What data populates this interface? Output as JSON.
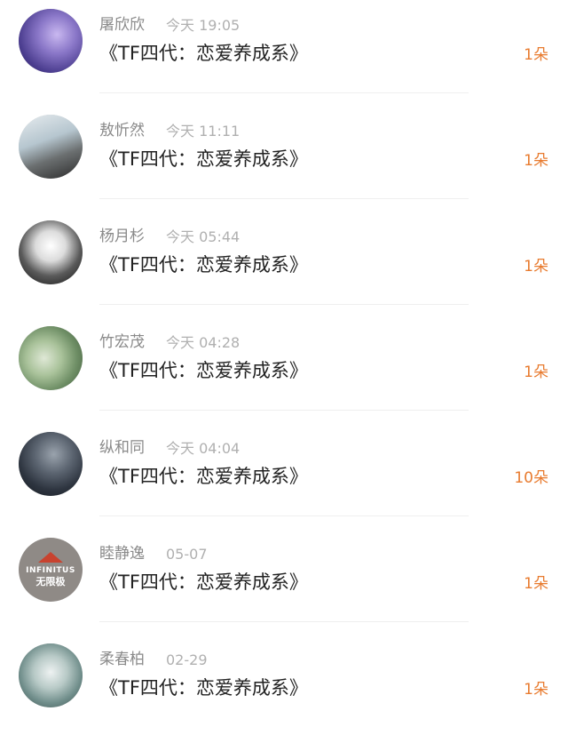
{
  "records": [
    {
      "name": "屠欣欣",
      "time": "今天 19:05",
      "title": "《TF四代：恋爱养成系》",
      "count": "1朵"
    },
    {
      "name": "敖忻然",
      "time": "今天 11:11",
      "title": "《TF四代：恋爱养成系》",
      "count": "1朵"
    },
    {
      "name": "杨月杉",
      "time": "今天 05:44",
      "title": "《TF四代：恋爱养成系》",
      "count": "1朵"
    },
    {
      "name": "竹宏茂",
      "time": "今天 04:28",
      "title": "《TF四代：恋爱养成系》",
      "count": "1朵"
    },
    {
      "name": "纵和同",
      "time": "今天 04:04",
      "title": "《TF四代：恋爱养成系》",
      "count": "10朵"
    },
    {
      "name": "睦静逸",
      "time": "05-07",
      "title": "《TF四代：恋爱养成系》",
      "count": "1朵",
      "avatar_logo": {
        "en": "INFINITUS",
        "cn": "无限极"
      }
    },
    {
      "name": "柔春柏",
      "time": "02-29",
      "title": "《TF四代：恋爱养成系》",
      "count": "1朵"
    }
  ],
  "colors": {
    "name": "#8a8a8a",
    "time": "#b0b0b0",
    "title": "#222222",
    "count": "#e87b2f",
    "divider": "#efefef"
  }
}
